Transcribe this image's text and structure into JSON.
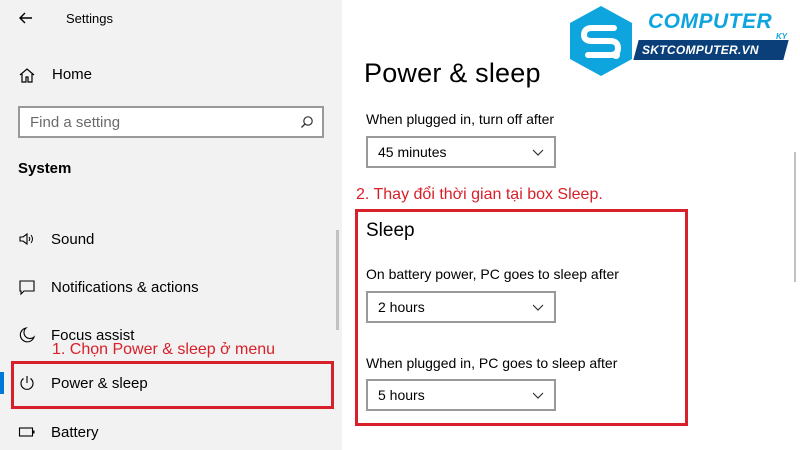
{
  "app": {
    "title": "Settings"
  },
  "sidebar": {
    "home_label": "Home",
    "search_placeholder": "Find a setting",
    "section_title": "System",
    "items": [
      {
        "label": "Sound",
        "icon": "speaker-icon"
      },
      {
        "label": "Notifications & actions",
        "icon": "message-icon"
      },
      {
        "label": "Focus assist",
        "icon": "moon-icon"
      },
      {
        "label": "Power & sleep",
        "icon": "power-icon",
        "selected": true
      },
      {
        "label": "Battery",
        "icon": "battery-icon"
      }
    ]
  },
  "main": {
    "page_title": "Power & sleep",
    "screen_label": "When plugged in, turn off after",
    "screen_value": "45 minutes",
    "sleep_heading": "Sleep",
    "battery_sleep_label": "On battery power, PC goes to sleep after",
    "battery_sleep_value": "2 hours",
    "plugged_sleep_label": "When plugged in, PC goes to sleep after",
    "plugged_sleep_value": "5 hours"
  },
  "annotations": {
    "step1": "1. Chọn Power & sleep ở menu",
    "step2": "2. Thay đổi thời gian tại box Sleep.",
    "color": "#d8202a"
  },
  "logo": {
    "word": "COMPUTER",
    "suffix": "KY",
    "url": "SKTCOMPUTER.VN",
    "colors": {
      "primary": "#0ea4dd",
      "dark": "#0a3f7a"
    }
  },
  "colors": {
    "accent": "#0078d7",
    "sidebar_bg": "#f2f2f2"
  }
}
